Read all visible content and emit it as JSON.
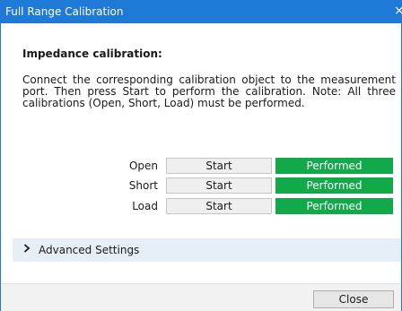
{
  "window": {
    "title": "Full Range Calibration",
    "close_glyph": "×",
    "accent_color": "#1e7ad6"
  },
  "main": {
    "heading": "Impedance calibration:",
    "description": "Connect the corresponding calibration object to the measurement port. Then press Start to perform the calibration. Note: All three calibrations (Open, Short, Load) must be performed.",
    "calibrations": [
      {
        "label": "Open",
        "button_label": "Start",
        "status": "Performed"
      },
      {
        "label": "Short",
        "button_label": "Start",
        "status": "Performed"
      },
      {
        "label": "Load",
        "button_label": "Start",
        "status": "Performed"
      }
    ],
    "status_color": "#12a94a",
    "advanced_settings": {
      "label": "Advanced Settings",
      "icon": "chevron-right-icon"
    }
  },
  "footer": {
    "close_label": "Close"
  }
}
